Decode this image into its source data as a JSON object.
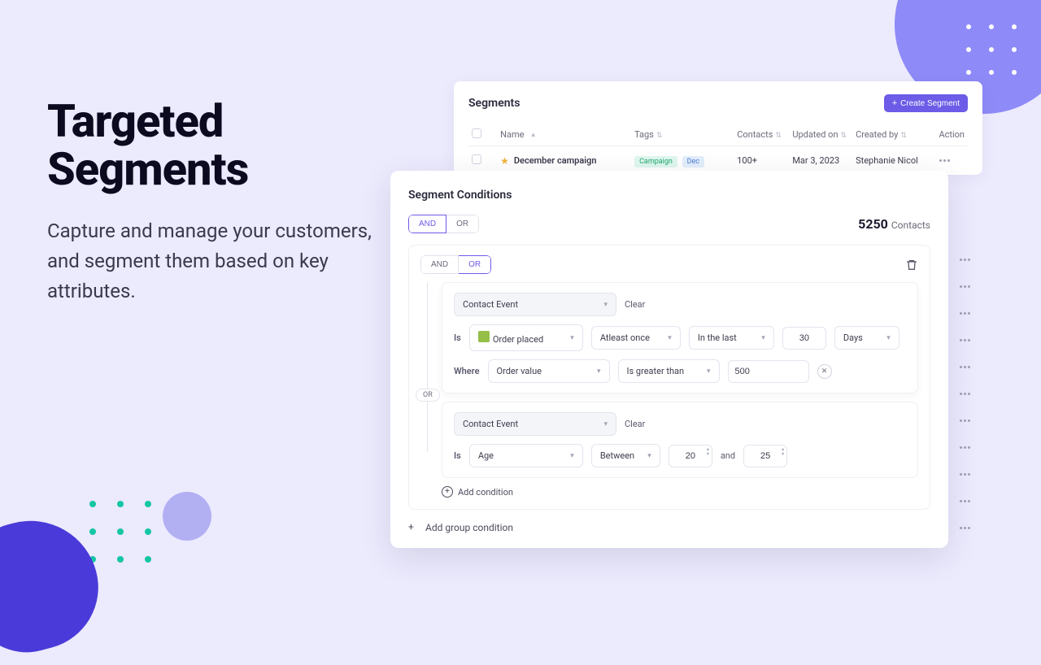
{
  "hero": {
    "title": "Targeted Segments",
    "subtitle": "Capture and manage your customers, and segment them based on key attributes."
  },
  "segments": {
    "title": "Segments",
    "create_label": "Create Segment",
    "columns": {
      "name": "Name",
      "tags": "Tags",
      "contacts": "Contacts",
      "updated": "Updated on",
      "created_by": "Created by",
      "action": "Action"
    },
    "row": {
      "name": "December campaign",
      "tags": [
        "Campaign",
        "Dec"
      ],
      "contacts": "100+",
      "updated": "Mar 3, 2023",
      "created_by": "Stephanie Nicol"
    }
  },
  "conditions": {
    "title": "Segment Conditions",
    "and": "AND",
    "or": "OR",
    "count": "5250",
    "count_label": "Contacts",
    "clear": "Clear",
    "is": "Is",
    "where": "Where",
    "and_word": "and",
    "add_condition": "Add condition",
    "add_group": "Add group condition",
    "rule1": {
      "type": "Contact Event",
      "event": "Order placed",
      "freq": "Atleast once",
      "window": "In the last",
      "number": "30",
      "unit": "Days",
      "where_field": "Order value",
      "where_op": "Is greater than",
      "where_val": "500"
    },
    "rule2": {
      "type": "Contact Event",
      "field": "Age",
      "op": "Between",
      "from": "20",
      "to": "25"
    }
  }
}
